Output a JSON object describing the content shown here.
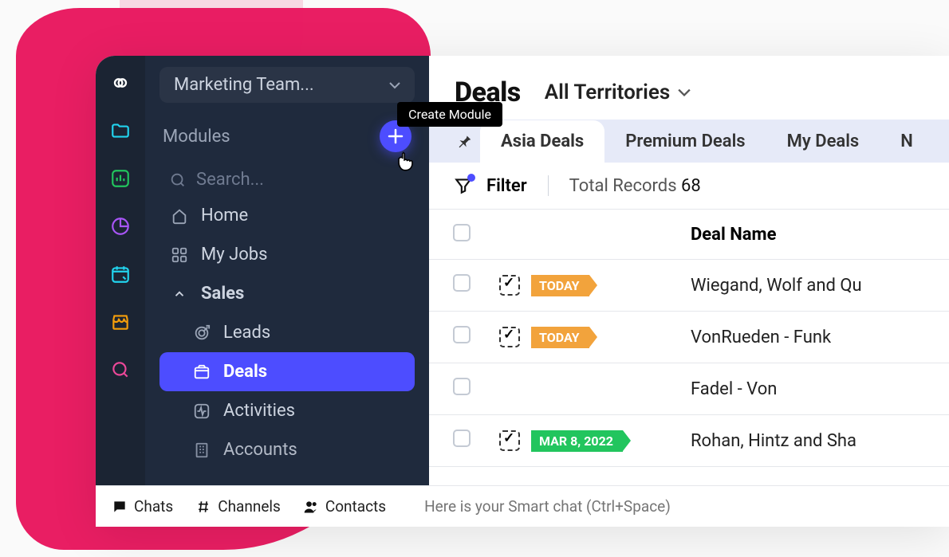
{
  "sidebar": {
    "team_label": "Marketing Team...",
    "modules_label": "Modules",
    "create_tooltip": "Create Module",
    "search_placeholder": "Search...",
    "items": {
      "home": "Home",
      "myjobs": "My Jobs",
      "sales": "Sales",
      "leads": "Leads",
      "deals": "Deals",
      "activities": "Activities",
      "accounts": "Accounts"
    }
  },
  "main": {
    "title": "Deals",
    "territory_label": "All Territories",
    "tabs": [
      "Asia Deals",
      "Premium Deals",
      "My Deals"
    ],
    "filter_label": "Filter",
    "total_label": "Total Records ",
    "total_count": "68",
    "columns": {
      "deal_name": "Deal Name"
    },
    "rows": [
      {
        "tag": "TODAY",
        "tag_color": "orange",
        "has_task": true,
        "name": "Wiegand, Wolf and Qu"
      },
      {
        "tag": "TODAY",
        "tag_color": "orange",
        "has_task": true,
        "name": "VonRueden - Funk"
      },
      {
        "tag": "",
        "tag_color": "",
        "has_task": false,
        "name": "Fadel - Von"
      },
      {
        "tag": "MAR 8, 2022",
        "tag_color": "green",
        "has_task": true,
        "name": "Rohan, Hintz and Sha"
      }
    ]
  },
  "bottombar": {
    "chats": "Chats",
    "channels": "Channels",
    "contacts": "Contacts",
    "smart_placeholder": "Here is your Smart chat (Ctrl+Space)"
  }
}
